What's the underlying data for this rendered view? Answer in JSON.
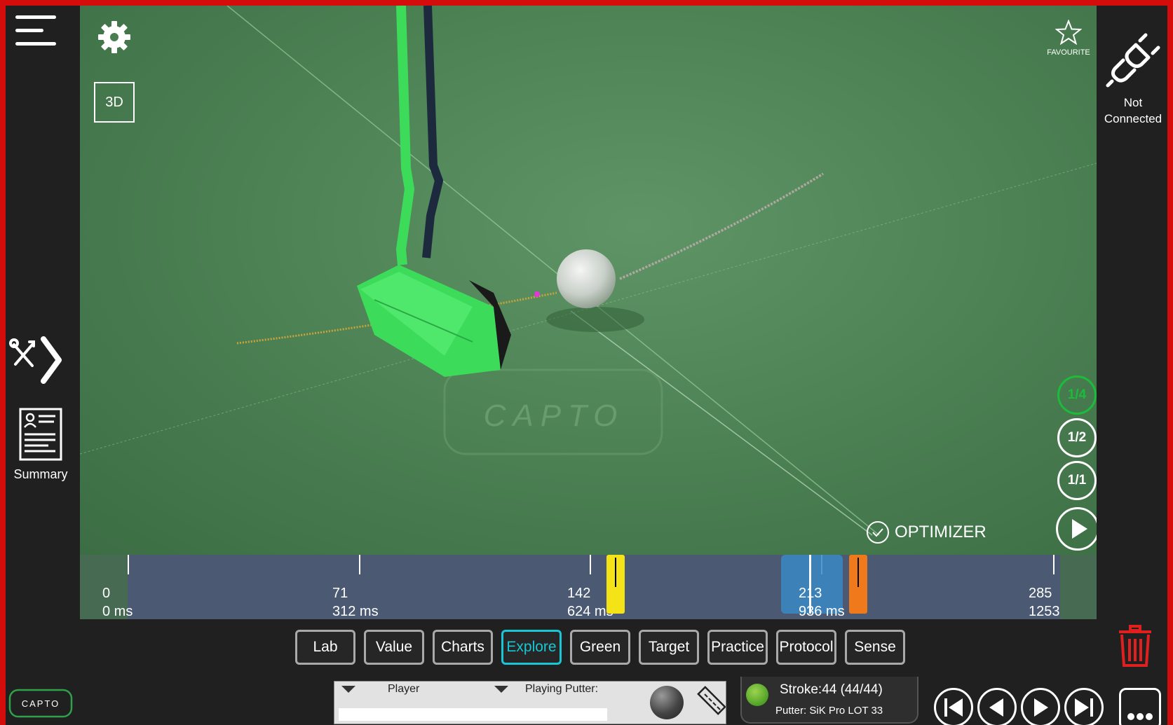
{
  "app": {
    "brand": "CAPTO",
    "summary_label": "Summary",
    "view_mode": "3D",
    "favourite_label": "FAVOURITE",
    "connection_status": "Not Connected",
    "optimizer_label": "OPTIMIZER",
    "watermark": "CAPTO"
  },
  "playback_speeds": [
    "1/4",
    "1/2",
    "1/1"
  ],
  "active_speed": "1/4",
  "timeline": {
    "frames": [
      "0",
      "71",
      "142",
      "213",
      "285"
    ],
    "times": [
      "0 ms",
      "312 ms",
      "624 ms",
      "936 ms",
      "1253"
    ]
  },
  "tabs": [
    {
      "label": "Lab"
    },
    {
      "label": "Value"
    },
    {
      "label": "Charts"
    },
    {
      "label": "Explore",
      "active": true
    },
    {
      "label": "Green"
    },
    {
      "label": "Target"
    },
    {
      "label": "Practice"
    },
    {
      "label": "Protocol"
    },
    {
      "label": "Sense"
    }
  ],
  "player_panel": {
    "player_label": "Player",
    "putter_label": "Playing Putter:"
  },
  "stroke": {
    "title": "Stroke:44 (44/44)",
    "putter": "Putter: SiK Pro LOT 33"
  },
  "colors": {
    "frame": "#d40c0c",
    "accent_tab": "#18c7d6",
    "active_speed": "#1dbb3c",
    "impact_marker": "#f4e316",
    "end_marker": "#f07a1b",
    "putter_head": "#3ddb5a"
  },
  "icons": [
    "menu-icon",
    "tools-icon",
    "summary-icon",
    "gear-icon",
    "star-icon",
    "unplug-icon",
    "check-icon",
    "play-icon",
    "skip-start-icon",
    "prev-icon",
    "next-icon",
    "skip-end-icon",
    "more-icon",
    "trash-icon",
    "ball-icon",
    "ruler-icon"
  ]
}
